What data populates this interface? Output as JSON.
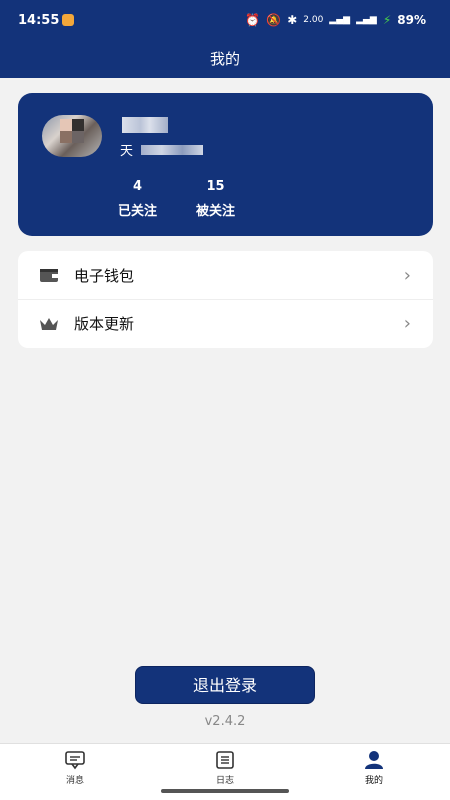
{
  "status_bar": {
    "time": "14:55",
    "speed": "2.00",
    "speed_unit": "KB/S",
    "battery": "89%"
  },
  "header": {
    "title": "我的"
  },
  "profile": {
    "subtitle_prefix": "天",
    "following": {
      "count": "4",
      "label": "已关注"
    },
    "followers": {
      "count": "15",
      "label": "被关注"
    }
  },
  "menu": [
    {
      "label": "电子钱包",
      "icon": "wallet-icon"
    },
    {
      "label": "版本更新",
      "icon": "crown-icon"
    }
  ],
  "logout_label": "退出登录",
  "version": "v2.4.2",
  "tabs": [
    {
      "label": "消息",
      "icon": "message-icon",
      "active": false
    },
    {
      "label": "日志",
      "icon": "log-icon",
      "active": false
    },
    {
      "label": "我的",
      "icon": "profile-icon",
      "active": true
    }
  ],
  "colors": {
    "primary": "#13337a",
    "background": "#f2f2f2"
  }
}
